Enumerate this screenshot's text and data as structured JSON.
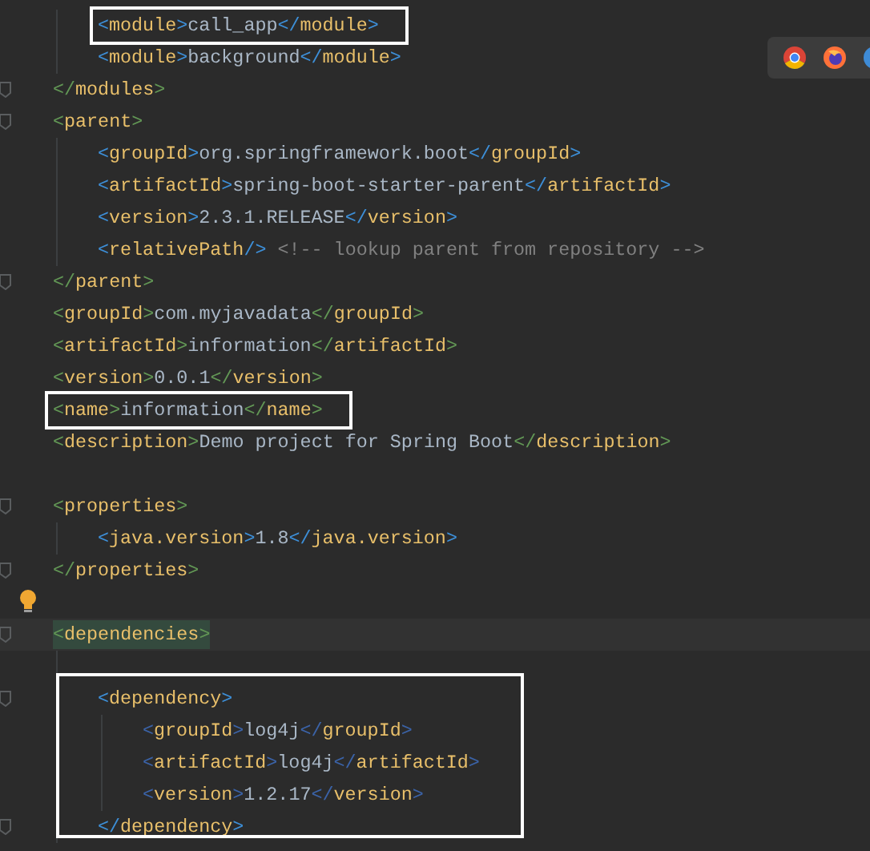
{
  "editor": {
    "lines": [
      {
        "children": [
          {
            "code": "<module>call_app</module>",
            "framed": true
          },
          {
            "code": "<module>background</module>"
          }
        ],
        "end": "</modules>"
      },
      {
        "code": "<parent>",
        "children": [
          {
            "code": "<groupId>org.springframework.boot</groupId>"
          },
          {
            "code": "<artifactId>spring-boot-starter-parent</artifactId>"
          },
          {
            "code": "<version>2.3.1.RELEASE</version>"
          },
          {
            "code": "<relativePath/> <!-- lookup parent from repository -->"
          }
        ],
        "end": "</parent>"
      },
      {
        "code": "<groupId>com.myjavadata</groupId>"
      },
      {
        "code": "<artifactId>information</artifactId>"
      },
      {
        "code": "<version>0.0.1</version>"
      },
      {
        "code": "<name>information</name>",
        "framed": true
      },
      {
        "code": "<description>Demo project for Spring Boot</description>"
      },
      {
        "kind": "blank"
      },
      {
        "code": "<properties>",
        "children": [
          {
            "code": "<java.version>1.8</java.version>"
          }
        ],
        "end": "</properties>"
      },
      {
        "kind": "blank",
        "hint": true
      },
      {
        "code": "<dependencies>",
        "current": true,
        "children": [
          {
            "kind": "blank"
          },
          {
            "code": "<dependency>",
            "framed": true,
            "children": [
              {
                "code": "<groupId>log4j</groupId>"
              },
              {
                "code": "<artifactId>log4j</artifactId>"
              },
              {
                "code": "<version>1.2.17</version>"
              }
            ],
            "end": "</dependency>"
          }
        ]
      }
    ]
  }
}
